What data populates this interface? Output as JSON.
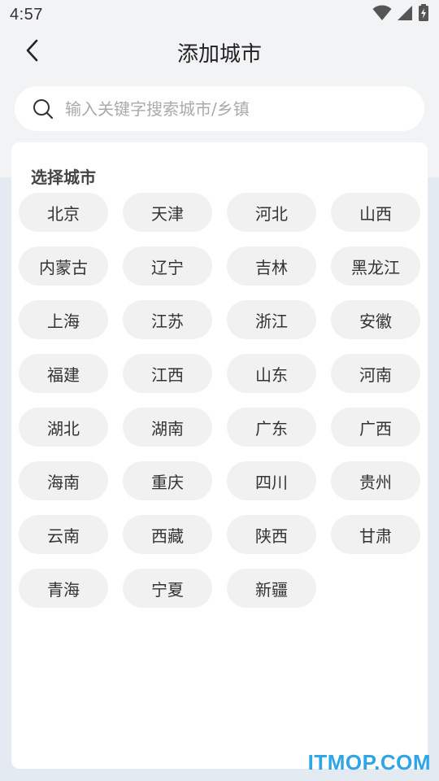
{
  "status_bar": {
    "time": "4:57",
    "icons": [
      "wifi-icon",
      "signal-icon",
      "battery-charging-icon"
    ]
  },
  "header": {
    "back_icon": "chevron-left-icon",
    "title": "添加城市"
  },
  "search": {
    "icon": "search-icon",
    "placeholder": "输入关键字搜索城市/乡镇",
    "value": ""
  },
  "city_panel": {
    "title": "选择城市",
    "cities": [
      "北京",
      "天津",
      "河北",
      "山西",
      "内蒙古",
      "辽宁",
      "吉林",
      "黑龙江",
      "上海",
      "江苏",
      "浙江",
      "安徽",
      "福建",
      "江西",
      "山东",
      "河南",
      "湖北",
      "湖南",
      "广东",
      "广西",
      "海南",
      "重庆",
      "四川",
      "贵州",
      "云南",
      "西藏",
      "陕西",
      "甘肃",
      "青海",
      "宁夏",
      "新疆"
    ]
  },
  "watermark": "ITMOP.COM",
  "colors": {
    "background": "#f2f3f5",
    "band": "#e4eaf2",
    "chip": "#f1f1f2",
    "watermark": "#2fa4e6"
  }
}
